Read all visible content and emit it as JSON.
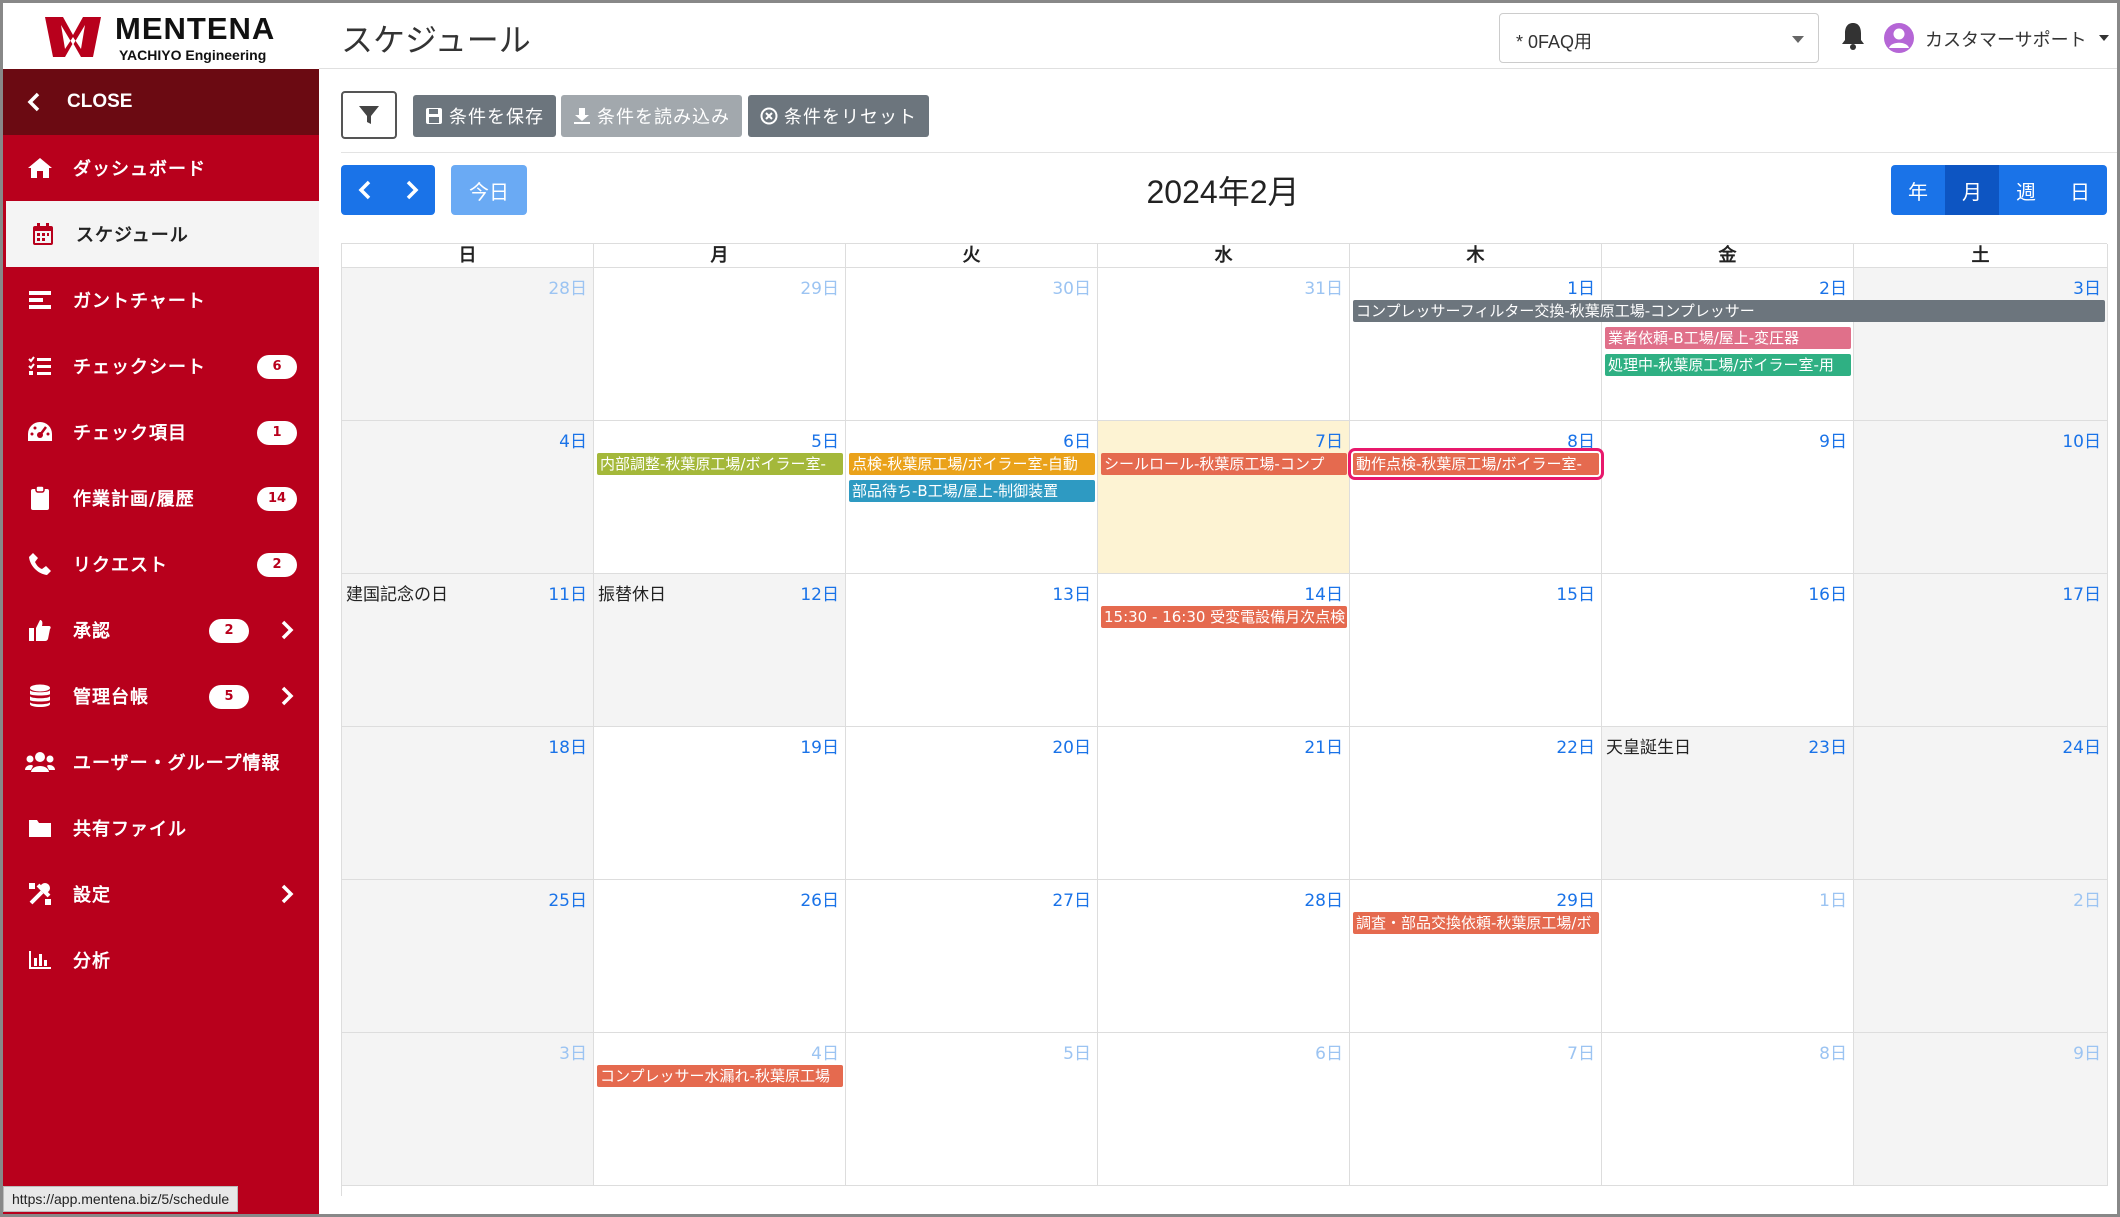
{
  "brand": {
    "name": "MENTENA",
    "sub": "YACHIYO Engineering"
  },
  "sidebar": {
    "close_label": "CLOSE",
    "items": [
      {
        "label": "ダッシュボード",
        "icon": "home-icon"
      },
      {
        "label": "スケジュール",
        "icon": "calendar-icon",
        "active": true
      },
      {
        "label": "ガントチャート",
        "icon": "bars-icon"
      },
      {
        "label": "チェックシート",
        "icon": "checklist-icon",
        "badge": "6"
      },
      {
        "label": "チェック項目",
        "icon": "gauge-icon",
        "badge": "1"
      },
      {
        "label": "作業計画/履歴",
        "icon": "clipboard-icon",
        "badge": "14"
      },
      {
        "label": "リクエスト",
        "icon": "phone-icon",
        "badge": "2"
      },
      {
        "label": "承認",
        "icon": "thumbs-up-icon",
        "badge": "2",
        "submenu": true
      },
      {
        "label": "管理台帳",
        "icon": "database-icon",
        "badge": "5",
        "submenu": true
      },
      {
        "label": "ユーザー・グループ情報",
        "icon": "users-icon"
      },
      {
        "label": "共有ファイル",
        "icon": "folder-icon"
      },
      {
        "label": "設定",
        "icon": "tools-icon",
        "submenu": true
      },
      {
        "label": "分析",
        "icon": "chart-icon"
      }
    ]
  },
  "status_url": "https://app.mentena.biz/5/schedule",
  "header": {
    "title": "スケジュール",
    "project": "* 0FAQ用",
    "user": "カスタマーサポート"
  },
  "toolbar": {
    "save": "条件を保存",
    "load": "条件を読み込み",
    "reset": "条件をリセット"
  },
  "calendar": {
    "today_label": "今日",
    "month_title": "2024年2月",
    "views": [
      "年",
      "月",
      "週",
      "日"
    ],
    "active_view": "月",
    "dow": [
      "日",
      "月",
      "火",
      "水",
      "木",
      "金",
      "土"
    ],
    "weeks": [
      [
        {
          "d": "28日",
          "o": true
        },
        {
          "d": "29日",
          "o": true
        },
        {
          "d": "30日",
          "o": true
        },
        {
          "d": "31日",
          "o": true
        },
        {
          "d": "1日"
        },
        {
          "d": "2日"
        },
        {
          "d": "3日"
        }
      ],
      [
        {
          "d": "4日"
        },
        {
          "d": "5日"
        },
        {
          "d": "6日"
        },
        {
          "d": "7日",
          "today": true
        },
        {
          "d": "8日"
        },
        {
          "d": "9日"
        },
        {
          "d": "10日"
        }
      ],
      [
        {
          "d": "11日",
          "hol": "建国記念の日"
        },
        {
          "d": "12日",
          "hol": "振替休日"
        },
        {
          "d": "13日"
        },
        {
          "d": "14日"
        },
        {
          "d": "15日"
        },
        {
          "d": "16日"
        },
        {
          "d": "17日"
        }
      ],
      [
        {
          "d": "18日"
        },
        {
          "d": "19日"
        },
        {
          "d": "20日"
        },
        {
          "d": "21日"
        },
        {
          "d": "22日"
        },
        {
          "d": "23日",
          "hol": "天皇誕生日"
        },
        {
          "d": "24日"
        }
      ],
      [
        {
          "d": "25日"
        },
        {
          "d": "26日"
        },
        {
          "d": "27日"
        },
        {
          "d": "28日"
        },
        {
          "d": "29日"
        },
        {
          "d": "1日",
          "o": true
        },
        {
          "d": "2日",
          "o": true
        }
      ],
      [
        {
          "d": "3日",
          "o": true
        },
        {
          "d": "4日",
          "o": true
        },
        {
          "d": "5日",
          "o": true
        },
        {
          "d": "6日",
          "o": true
        },
        {
          "d": "7日",
          "o": true
        },
        {
          "d": "8日",
          "o": true
        },
        {
          "d": "9日",
          "o": true
        }
      ]
    ],
    "events": [
      {
        "title": "コンプレッサーフィルター交換-秋葉原工場-コンプレッサー",
        "week": 0,
        "col": 4,
        "span": 3,
        "slot": 0,
        "color": "#6c757d"
      },
      {
        "title": "業者依頼-B工場/屋上-変圧器",
        "week": 0,
        "col": 5,
        "span": 1,
        "slot": 1,
        "color": "#e0708a"
      },
      {
        "title": "処理中-秋葉原工場/ボイラー室-用",
        "week": 0,
        "col": 5,
        "span": 1,
        "slot": 2,
        "color": "#2fb083"
      },
      {
        "title": "内部調整-秋葉原工場/ボイラー室-",
        "week": 1,
        "col": 1,
        "span": 1,
        "slot": 0,
        "color": "#a4b83a"
      },
      {
        "title": "点検-秋葉原工場/ボイラー室-自動",
        "week": 1,
        "col": 2,
        "span": 1,
        "slot": 0,
        "color": "#eaa21a"
      },
      {
        "title": "部品待ち-B工場/屋上-制御装置",
        "week": 1,
        "col": 2,
        "span": 1,
        "slot": 1,
        "color": "#2e9ac2"
      },
      {
        "title": "シールロール-秋葉原工場-コンプ",
        "week": 1,
        "col": 3,
        "span": 1,
        "slot": 0,
        "color": "#e56a4f"
      },
      {
        "title": "動作点検-秋葉原工場/ボイラー室-",
        "week": 1,
        "col": 4,
        "span": 1,
        "slot": 0,
        "color": "#e56a4f",
        "highlight": true
      },
      {
        "title": "15:30 - 16:30 受変電設備月次点検",
        "week": 2,
        "col": 3,
        "span": 1,
        "slot": 0,
        "color": "#e56a4f"
      },
      {
        "title": "調査・部品交換依頼-秋葉原工場/ボ",
        "week": 4,
        "col": 4,
        "span": 1,
        "slot": 0,
        "color": "#e56a4f"
      },
      {
        "title": "コンプレッサー水漏れ-秋葉原工場",
        "week": 5,
        "col": 1,
        "span": 1,
        "slot": 0,
        "color": "#e56a4f"
      }
    ]
  }
}
